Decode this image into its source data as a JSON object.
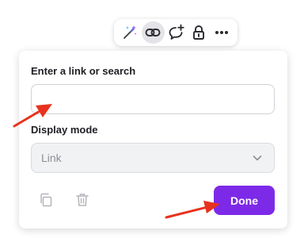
{
  "toolbar": {
    "items": [
      {
        "name": "magic-edit",
        "icon": "magic-wand-icon"
      },
      {
        "name": "link",
        "icon": "link-icon",
        "active": true
      },
      {
        "name": "comment",
        "icon": "add-comment-icon"
      },
      {
        "name": "lock",
        "icon": "lock-icon"
      },
      {
        "name": "more",
        "icon": "more-horizontal-icon"
      }
    ]
  },
  "link_panel": {
    "link_label": "Enter a link or search",
    "link_value": "",
    "link_placeholder": "",
    "display_mode_label": "Display mode",
    "display_mode_value": "Link",
    "copy_icon": "copy-icon",
    "delete_icon": "trash-icon",
    "done_label": "Done"
  },
  "annotations": {
    "arrow_color": "#e8321e"
  },
  "colors": {
    "accent": "#7d2ae8",
    "accent_text": "#ffffff"
  }
}
